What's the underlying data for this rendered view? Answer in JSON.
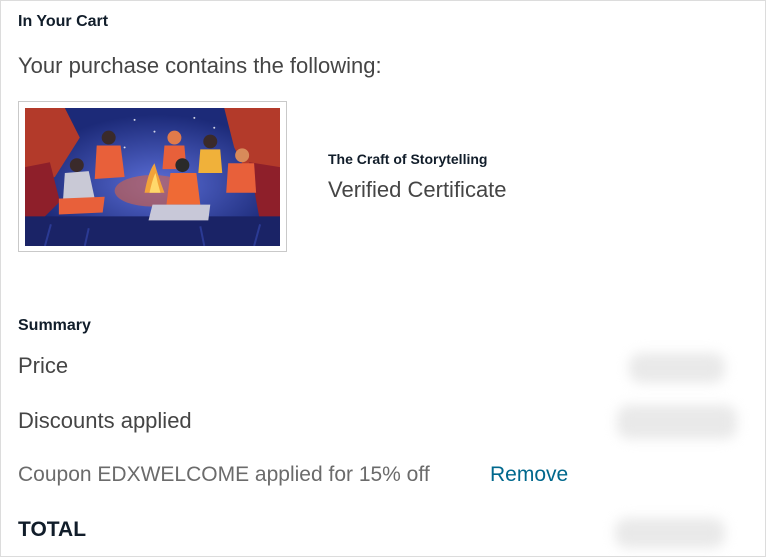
{
  "cart": {
    "heading": "In Your Cart",
    "intro": "Your purchase contains the following:"
  },
  "course": {
    "image_icon": "campfire-storytelling-illustration",
    "title": "The Craft of Storytelling",
    "mode": "Verified Certificate"
  },
  "summary": {
    "heading": "Summary",
    "price_label": "Price",
    "discount_label": "Discounts applied",
    "coupon_text": "Coupon EDXWELCOME applied for 15% off",
    "remove_label": "Remove",
    "total_label": "TOTAL"
  },
  "colors": {
    "heading": "#111d2a",
    "link": "#00688d",
    "text": "#454545"
  }
}
